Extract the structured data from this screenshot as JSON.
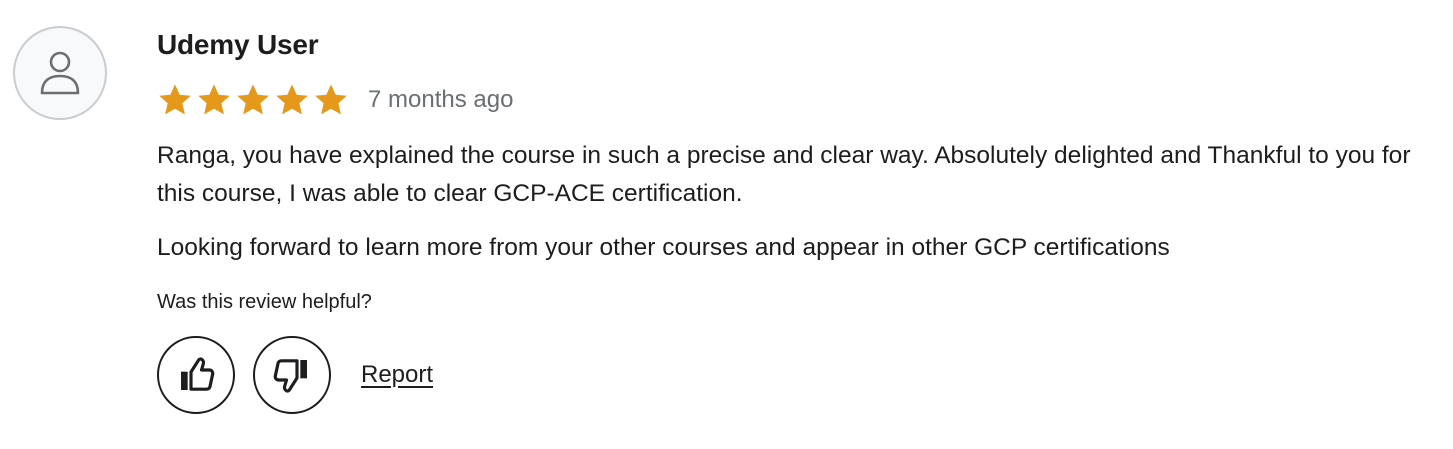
{
  "review": {
    "reviewer_name": "Udemy User",
    "avatar_icon": "user-icon",
    "rating": 5,
    "rating_max": 5,
    "star_color": "#e59819",
    "timestamp": "7 months ago",
    "paragraphs": [
      "Ranga, you have explained the course in such a precise and clear way. Absolutely delighted and Thankful to you for this course, I was able to clear GCP-ACE certification.",
      "Looking forward to learn more from your other courses and appear in other GCP certifications"
    ]
  },
  "feedback": {
    "question": "Was this review helpful?",
    "helpful_icon": "thumbs-up-icon",
    "not_helpful_icon": "thumbs-down-icon",
    "report_label": "Report"
  }
}
